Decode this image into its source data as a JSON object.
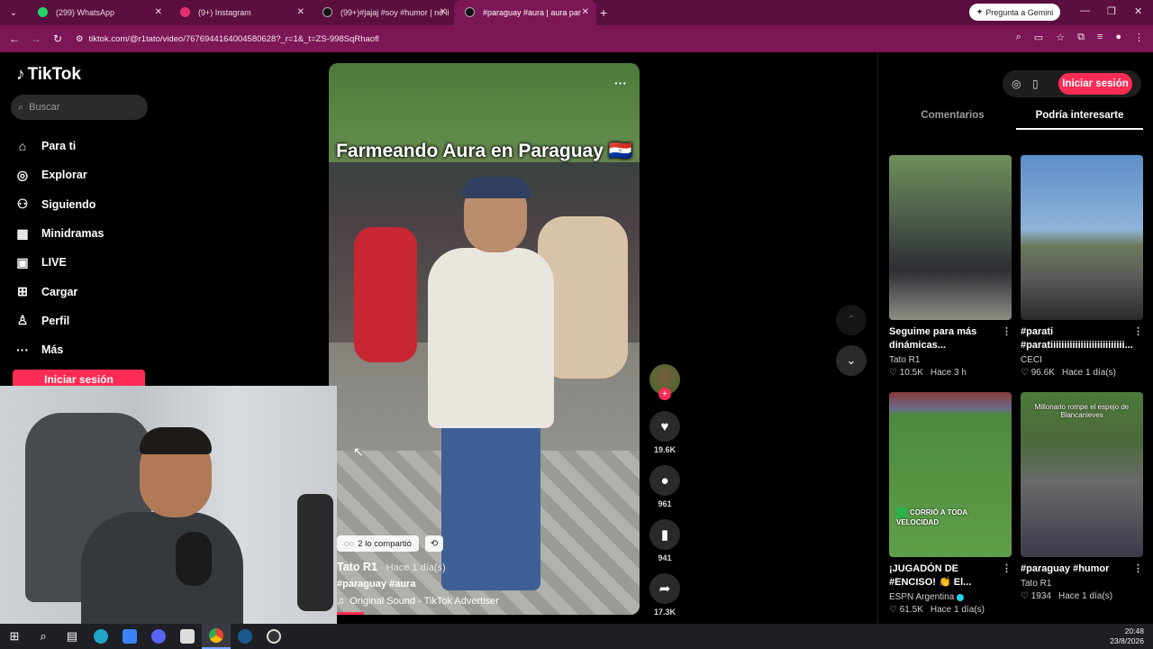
{
  "browser": {
    "tabs": [
      {
        "title": "(299) WhatsApp",
        "icon": "whatsapp-icon",
        "color": "#25d366"
      },
      {
        "title": "(9+) Instagram",
        "icon": "instagram-icon",
        "color": "#e1306c"
      },
      {
        "title": "(99+)#jajaj #soy #humor | no li",
        "icon": "tiktok-icon",
        "color": "#111111"
      },
      {
        "title": "#paraguay #aura | aura par",
        "icon": "tiktok-icon",
        "color": "#111111",
        "active": true
      }
    ],
    "gemini_label": "Pregunta a Gemini",
    "url_site_info": "⚙",
    "url": "tiktok.com/@r1tato/video/7676944164004580628?_r=1&_t=ZS-998SqRhaofl"
  },
  "sidebar": {
    "logo": "TikTok",
    "search_placeholder": "Buscar",
    "items": [
      {
        "label": "Para ti",
        "icon": "home-icon"
      },
      {
        "label": "Explorar",
        "icon": "compass-icon"
      },
      {
        "label": "Siguiendo",
        "icon": "following-icon"
      },
      {
        "label": "Minidramas",
        "icon": "film-icon"
      },
      {
        "label": "LIVE",
        "icon": "live-icon"
      },
      {
        "label": "Cargar",
        "icon": "upload-icon"
      },
      {
        "label": "Perfil",
        "icon": "profile-icon"
      },
      {
        "label": "Más",
        "icon": "more-icon"
      }
    ],
    "login_label": "Iniciar sesión"
  },
  "video": {
    "caption": "Farmeando Aura en Paraguay 🇵🇾",
    "shared_label": "2 lo compartió",
    "author": "Tato R1",
    "posted": " · Hace 1 día(s)",
    "hashtags": "#paraguay #aura",
    "sound": "Original Sound - TikTok Advertiser",
    "likes": "19.6K",
    "comments": "961",
    "saves": "941",
    "shares": "17.3K"
  },
  "right_panel": {
    "login_label": "Iniciar sesión",
    "tabs": [
      "Comentarios",
      "Podría interesarte"
    ],
    "active_tab": 1,
    "cards": [
      {
        "title": "Seguime para más dinámicas...",
        "author": "Tato R1",
        "likes": "10.5K",
        "posted": "Hace 3 h",
        "verified": false,
        "thumb_caption": ""
      },
      {
        "title": "#parati #paratiiiiiiiiiiiiiiiiiiiiiiiiiii...",
        "author": "CECI",
        "likes": "96.6K",
        "posted": "Hace 1 día(s)",
        "verified": false,
        "thumb_caption": ""
      },
      {
        "title": "¡JUGADÓN DE #ENCISO! 👏 El...",
        "author": "ESPN Argentina",
        "likes": "61.5K",
        "posted": "Hace 1 día(s)",
        "verified": true,
        "thumb_caption": "CORRIÓ A TODA VELOCIDAD"
      },
      {
        "title": "#paraguay #humor",
        "author": "Tato R1",
        "likes": "1934",
        "posted": "Hace 1 día(s)",
        "verified": false,
        "thumb_caption": "Millonario rompe el espejo de Blancanieves"
      }
    ]
  },
  "taskbar": {
    "time": "20:48",
    "date": "23/8/2026"
  },
  "colors": {
    "tab_strip": "#5b0f3f",
    "toolbar": "#7c1656",
    "accent": "#fe2c55"
  }
}
